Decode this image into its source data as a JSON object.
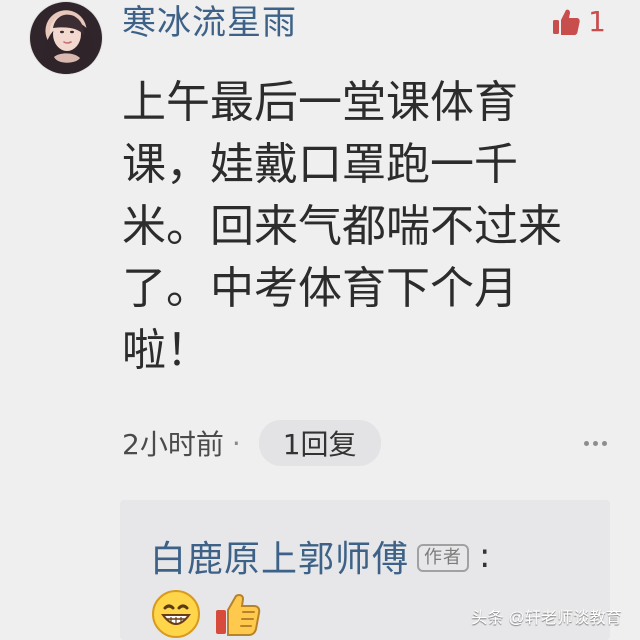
{
  "header": {
    "username": "寒冰流星雨",
    "like_count": "1",
    "like_icon": "thumbs-up-icon"
  },
  "comment": {
    "text": "上午最后一堂课体育课，娃戴口罩跑一千米。回来气都喘不过来了。中考体育下个月啦！",
    "time": "2小时前",
    "separator": "·",
    "reply_count_label": "1回复"
  },
  "reply_preview": {
    "author": "白鹿原上郭师傅",
    "author_badge": "作者",
    "colon": ":",
    "emoji_icons": [
      "grin-emoji-icon",
      "thumbs-up-emoji-icon"
    ]
  },
  "watermark": {
    "text": "头条 @轩老师谈教育"
  },
  "colors": {
    "background": "#efeff0",
    "username_blue": "#3e6287",
    "like_red": "#c84d4d"
  }
}
